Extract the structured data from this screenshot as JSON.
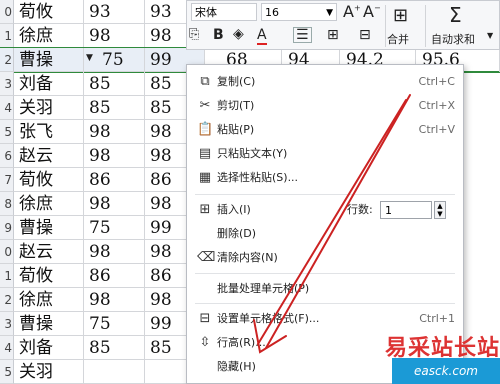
{
  "rows": [
    {
      "num": "0",
      "name": "荀攸",
      "a": "93",
      "b": "93"
    },
    {
      "num": "1",
      "name": "徐庶",
      "a": "98",
      "b": "98"
    },
    {
      "num": "2",
      "name": "曹操",
      "a": "75",
      "b": "99",
      "c": "68",
      "d": "94",
      "e": "94.2",
      "f": "95.6",
      "selected": true
    },
    {
      "num": "3",
      "name": "刘备",
      "a": "85",
      "b": "85"
    },
    {
      "num": "4",
      "name": "关羽",
      "a": "85",
      "b": "85"
    },
    {
      "num": "5",
      "name": "张飞",
      "a": "98",
      "b": "98"
    },
    {
      "num": "6",
      "name": "赵云",
      "a": "98",
      "b": "98"
    },
    {
      "num": "7",
      "name": "荀攸",
      "a": "86",
      "b": "86"
    },
    {
      "num": "8",
      "name": "徐庶",
      "a": "98",
      "b": "98"
    },
    {
      "num": "9",
      "name": "曹操",
      "a": "75",
      "b": "99"
    },
    {
      "num": "0",
      "name": "赵云",
      "a": "98",
      "b": "98"
    },
    {
      "num": "1",
      "name": "荀攸",
      "a": "86",
      "b": "86"
    },
    {
      "num": "2",
      "name": "徐庶",
      "a": "98",
      "b": "98"
    },
    {
      "num": "3",
      "name": "曹操",
      "a": "75",
      "b": "99"
    },
    {
      "num": "4",
      "name": "刘备",
      "a": "85",
      "b": "85"
    },
    {
      "num": "5",
      "name": "关羽",
      "a": "",
      "b": ""
    }
  ],
  "toolbar": {
    "font": "宋体",
    "size": "16",
    "merge": "合并",
    "autosum": "自动求和",
    "icons": [
      "font-grow-icon",
      "font-shrink-icon",
      "border-icon",
      "merge-icon",
      "sum-icon"
    ]
  },
  "menu": {
    "copy": "复制(C)",
    "copy_sc": "Ctrl+C",
    "cut": "剪切(T)",
    "cut_sc": "Ctrl+X",
    "paste": "粘贴(P)",
    "paste_sc": "Ctrl+V",
    "paste_text": "只粘贴文本(Y)",
    "paste_special": "选择性粘贴(S)...",
    "insert": "插入(I)",
    "rows_label": "行数:",
    "rows_value": "1",
    "delete": "删除(D)",
    "clear": "清除内容(N)",
    "batch": "批量处理单元格(P)",
    "format": "设置单元格格式(F)...",
    "format_sc": "Ctrl+1",
    "row_height": "行高(R)...",
    "hide": "隐藏(H)"
  },
  "watermark": {
    "text": "易采站长站",
    "url": "easck.com"
  },
  "colors": {
    "selection_border": "#2f8a3c",
    "arrow": "#cc2222",
    "watermark": "#d33333",
    "watermark_band": "#1b9ad6"
  }
}
